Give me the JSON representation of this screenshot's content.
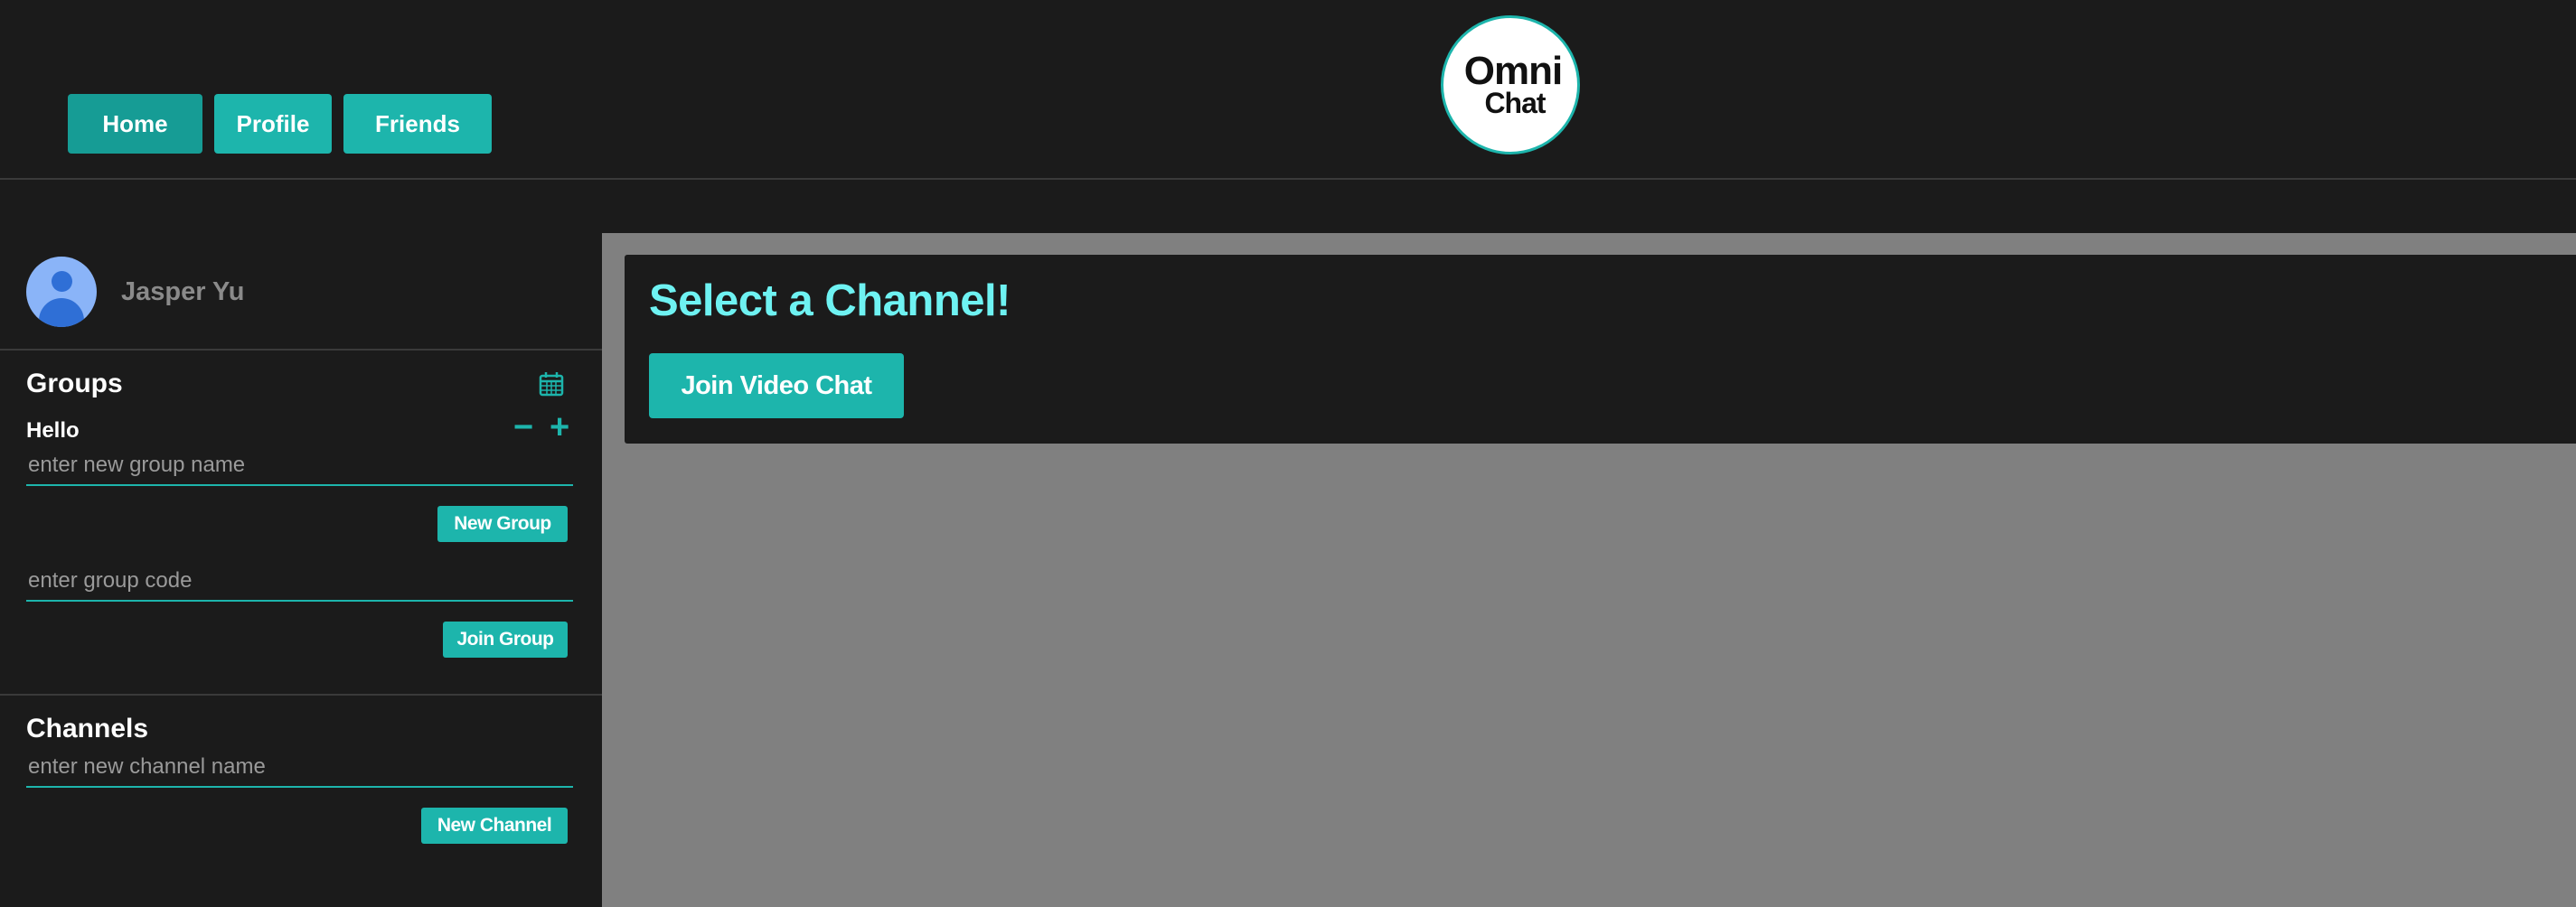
{
  "nav": {
    "items": [
      {
        "label": "Home",
        "active": true
      },
      {
        "label": "Profile",
        "active": false
      },
      {
        "label": "Friends",
        "active": false
      }
    ]
  },
  "logo": {
    "line1": "Omni",
    "line2": "Chat"
  },
  "user": {
    "name": "Jasper Yu",
    "avatar_icon": "user-avatar-icon"
  },
  "groups": {
    "title": "Groups",
    "calendar_icon": "calendar-icon",
    "items": [
      {
        "name": "Hello"
      }
    ],
    "remove_label": "−",
    "add_label": "+",
    "new_group_placeholder": "enter new group name",
    "new_group_button": "New Group",
    "group_code_placeholder": "enter group code",
    "join_group_button": "Join Group"
  },
  "channels": {
    "title": "Channels",
    "new_channel_placeholder": "enter new channel name",
    "new_channel_button": "New Channel"
  },
  "main": {
    "title": "Select a Channel!",
    "video_button": "Join Video Chat"
  },
  "colors": {
    "accent": "#1db5ac",
    "title": "#6ef2f2",
    "background": "#1b1b1b",
    "content_background": "#808080"
  }
}
